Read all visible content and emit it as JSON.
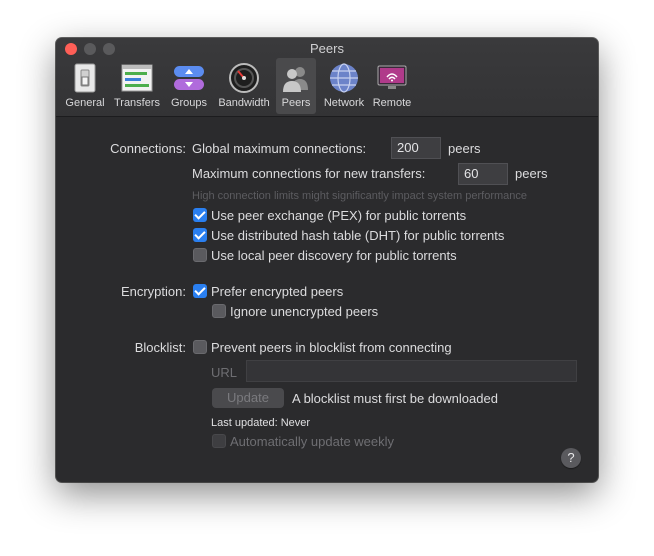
{
  "window": {
    "title": "Peers"
  },
  "toolbar": [
    {
      "label": "General",
      "icon": "general-switch-icon"
    },
    {
      "label": "Transfers",
      "icon": "transfers-icon"
    },
    {
      "label": "Groups",
      "icon": "groups-icon"
    },
    {
      "label": "Bandwidth",
      "icon": "bandwidth-gauge-icon"
    },
    {
      "label": "Peers",
      "icon": "peers-icon",
      "selected": true
    },
    {
      "label": "Network",
      "icon": "network-globe-icon"
    },
    {
      "label": "Remote",
      "icon": "remote-monitor-icon"
    }
  ],
  "connections": {
    "section_label": "Connections:",
    "global_label": "Global maximum connections:",
    "global_value": "200",
    "global_unit": "peers",
    "per_transfer_label": "Maximum connections for new transfers:",
    "per_transfer_value": "60",
    "per_transfer_unit": "peers",
    "warning": "High connection limits might significantly impact system performance",
    "pex": {
      "label": "Use peer exchange (PEX) for public torrents",
      "checked": true
    },
    "dht": {
      "label": "Use distributed hash table (DHT) for public torrents",
      "checked": true
    },
    "lpd": {
      "label": "Use local peer discovery for public torrents",
      "checked": false
    }
  },
  "encryption": {
    "section_label": "Encryption:",
    "prefer": {
      "label": "Prefer encrypted peers",
      "checked": true
    },
    "ignore": {
      "label": "Ignore unencrypted peers",
      "checked": false
    }
  },
  "blocklist": {
    "section_label": "Blocklist:",
    "prevent": {
      "label": "Prevent peers in blocklist from connecting",
      "checked": false
    },
    "url_label": "URL",
    "url_value": "",
    "update_button": "Update",
    "status": "A blocklist must first be downloaded",
    "last_updated": "Last updated: Never",
    "auto_update": {
      "label": "Automatically update weekly",
      "checked": false
    }
  },
  "help_button": "?"
}
